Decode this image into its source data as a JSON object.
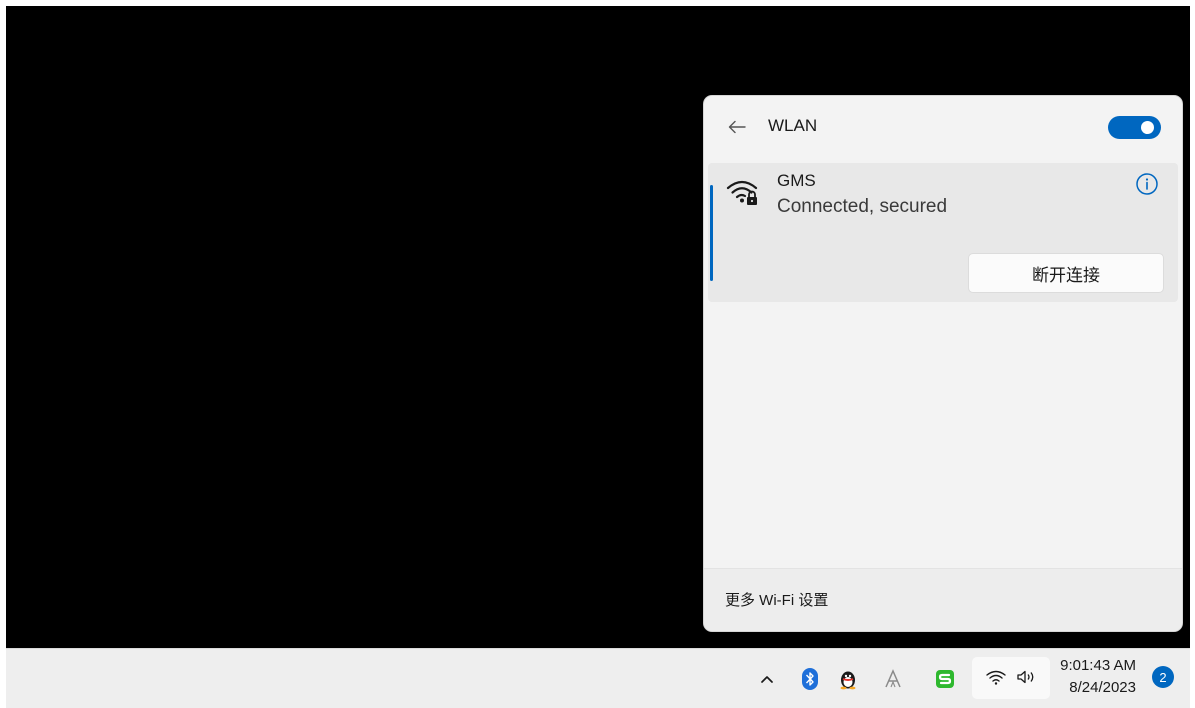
{
  "wlan_panel": {
    "title": "WLAN",
    "back_icon": "arrow-left-icon",
    "toggle_on": true,
    "network": {
      "name": "GMS",
      "status": "Connected, secured",
      "icon": "wifi-secured-icon",
      "disconnect_label": "断开连接"
    },
    "footer_link": "更多 Wi-Fi 设置"
  },
  "taskbar": {
    "tray_icons": [
      "chevron-up-icon",
      "bluetooth-icon",
      "qq-icon",
      "font-a-icon",
      "sogou-s-icon",
      "wifi-icon",
      "volume-icon"
    ],
    "time": "9:01:43 AM",
    "date": "8/24/2023",
    "notification_count": "2"
  },
  "colors": {
    "accent": "#0067c0",
    "bluetooth": "#1e6fd9",
    "sogou_green": "#2eb82e"
  }
}
